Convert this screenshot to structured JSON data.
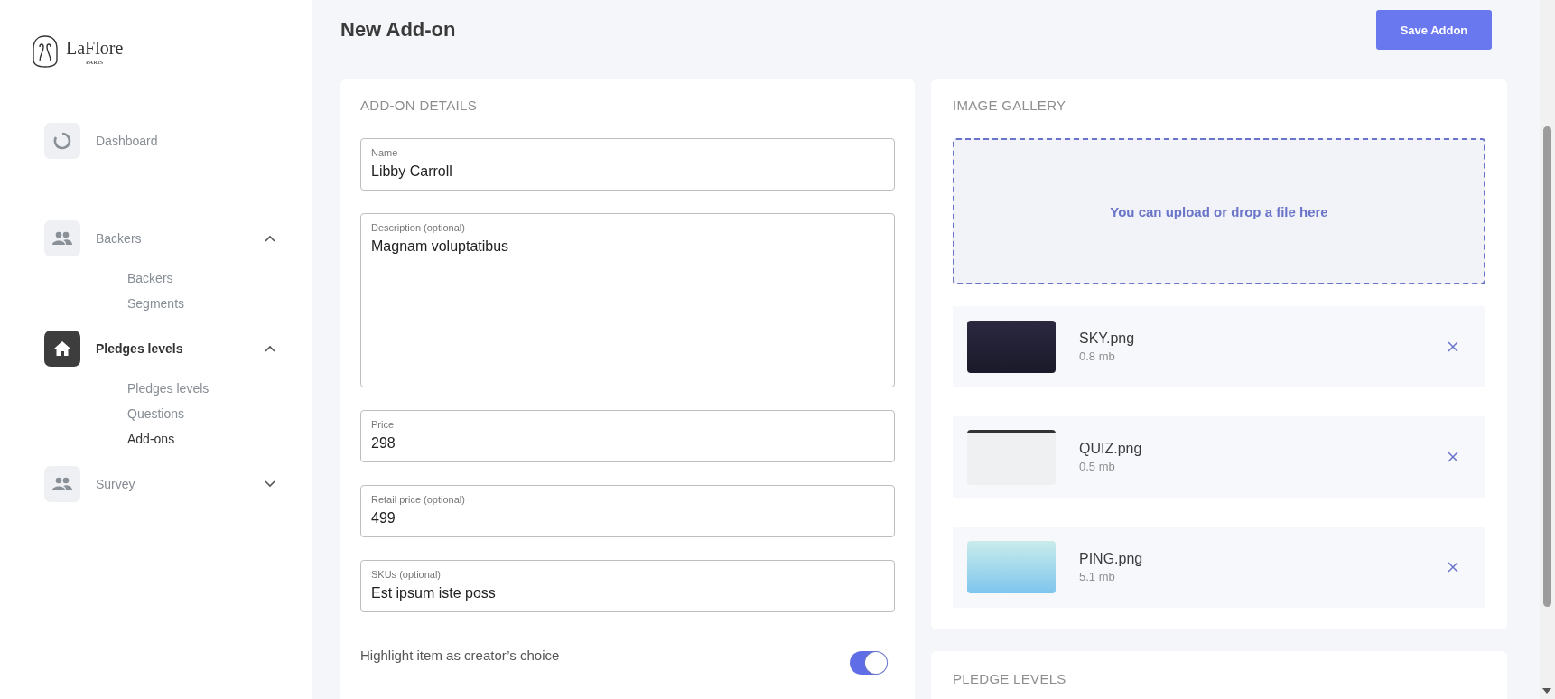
{
  "brand": {
    "name": "LaFlore",
    "tagline": "PARIS"
  },
  "sidebar": {
    "items": [
      {
        "label": "Dashboard",
        "kind": "dashboard",
        "selected": false
      },
      {
        "label": "Backers",
        "kind": "people",
        "selected": false,
        "expanded": true,
        "children": [
          {
            "label": "Backers",
            "selected": false
          },
          {
            "label": "Segments",
            "selected": false
          }
        ]
      },
      {
        "label": "Pledges levels",
        "kind": "home",
        "selected": true,
        "expanded": true,
        "children": [
          {
            "label": "Pledges levels",
            "selected": false
          },
          {
            "label": "Questions",
            "selected": false
          },
          {
            "label": "Add-ons",
            "selected": true
          }
        ]
      },
      {
        "label": "Survey",
        "kind": "people",
        "selected": false,
        "expanded": false
      }
    ]
  },
  "page": {
    "title": "New Add-on",
    "save_button": "Save Addon"
  },
  "details": {
    "heading": "ADD-ON DETAILS",
    "fields": [
      {
        "label": "Name",
        "value": "Libby Carroll",
        "kind": "input"
      },
      {
        "label": "Description (optional)",
        "value": "Magnam voluptatibus",
        "kind": "textarea"
      },
      {
        "label": "Price",
        "value": "298",
        "kind": "input"
      },
      {
        "label": "Retail price (optional)",
        "value": "499",
        "kind": "input"
      },
      {
        "label": "SKUs (optional)",
        "value": "Est ipsum iste poss",
        "kind": "input"
      }
    ],
    "highlight": {
      "label": "Highlight item as creator’s choice",
      "on": true
    }
  },
  "gallery": {
    "heading": "IMAGE GALLERY",
    "dropzone": "You can upload or drop a file here",
    "images": [
      {
        "name": "SKY.png",
        "size": "0.8 mb",
        "kind": "city"
      },
      {
        "name": "QUIZ.png",
        "size": "0.5 mb",
        "kind": "screenshot"
      },
      {
        "name": "PING.png",
        "size": "5.1 mb",
        "kind": "penguin"
      }
    ]
  },
  "pledge_levels": {
    "heading": "PLEDGE LEVELS"
  }
}
